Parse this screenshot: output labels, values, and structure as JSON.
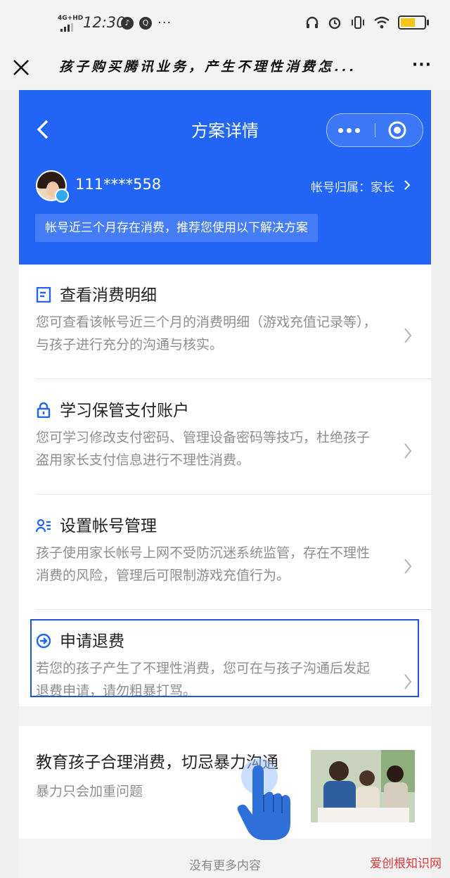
{
  "status_bar": {
    "network": "4G+HD",
    "time": "12:30",
    "more": "···"
  },
  "title_bar": {
    "title": "孩子购买腾讯业务，产生不理性消费怎...",
    "more": "···"
  },
  "page": {
    "title": "方案详情",
    "account": "111****558",
    "owner": "帐号归属：家长",
    "notice": "帐号近三个月存在消费，推荐您使用以下解决方案"
  },
  "items": [
    {
      "title": "查看消费明细",
      "desc": "您可查看该帐号近三个月的消费明细（游戏充值记录等），与孩子进行充分的沟通与核实。",
      "icon": "document-icon"
    },
    {
      "title": "学习保管支付账户",
      "desc": "您可学习修改支付密码、管理设备密码等技巧，杜绝孩子盗用家长支付信息进行不理性消费。",
      "icon": "lock-icon"
    },
    {
      "title": "设置帐号管理",
      "desc": "孩子使用家长帐号上网不受防沉迷系统监管，存在不理性消费的风险，管理后可限制游戏充值行为。",
      "icon": "user-list-icon"
    },
    {
      "title": "申请退费",
      "desc": "若您的孩子产生了不理性消费，您可在与孩子沟通后发起退费申请，请勿粗暴打骂。",
      "icon": "arrow-circle-icon"
    }
  ],
  "article": {
    "title": "教育孩子合理消费，切忌暴力沟通",
    "subtitle": "暴力只会加重问题"
  },
  "footer": {
    "no_more": "没有更多内容"
  },
  "watermark": "爱创根知识网",
  "colors": {
    "primary": "#2265f5",
    "highlight_border": "#1f56d6"
  }
}
